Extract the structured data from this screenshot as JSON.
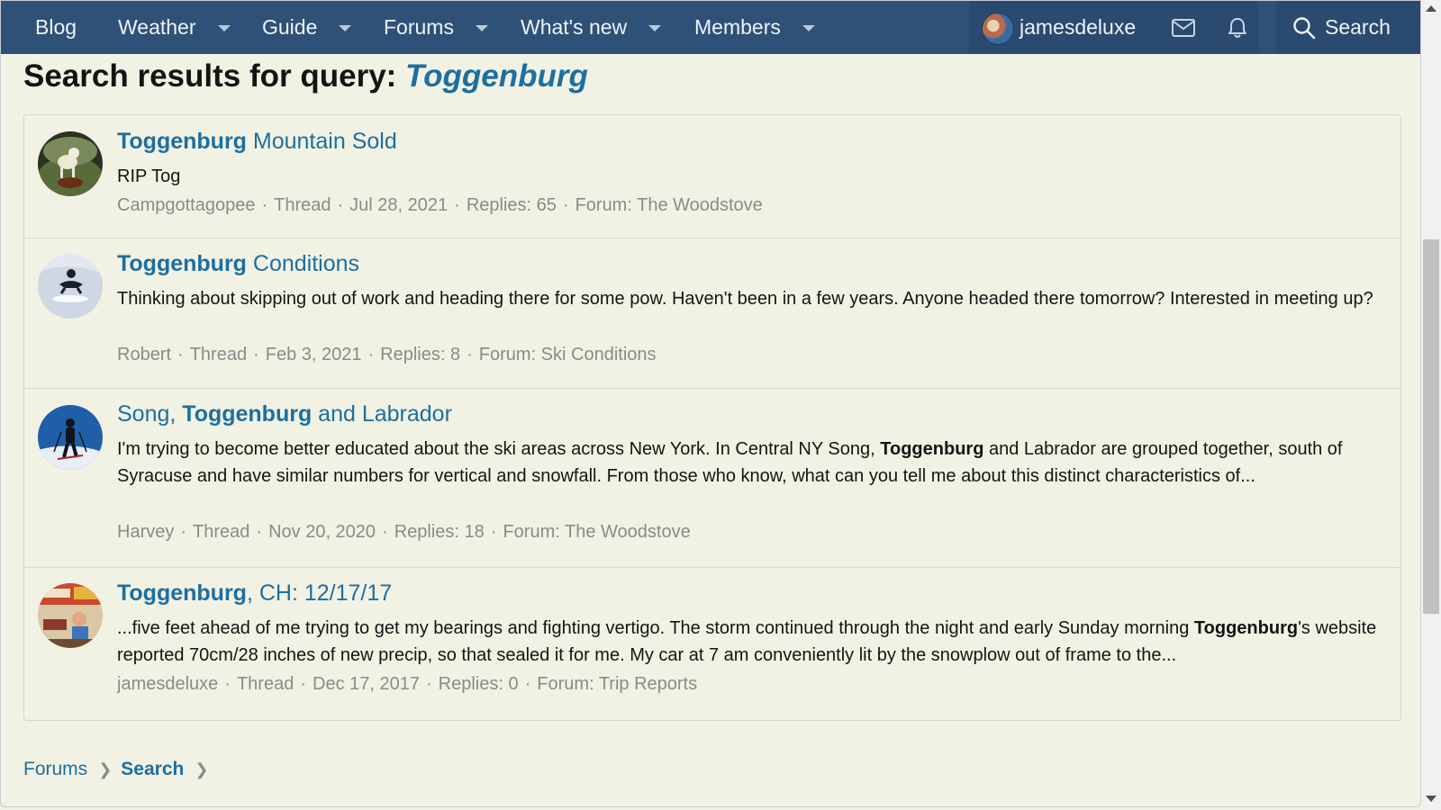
{
  "nav": {
    "items": [
      {
        "label": "Blog",
        "has_menu": false
      },
      {
        "label": "Weather",
        "has_menu": true
      },
      {
        "label": "Guide",
        "has_menu": true
      },
      {
        "label": "Forums",
        "has_menu": true
      },
      {
        "label": "What's new",
        "has_menu": true
      },
      {
        "label": "Members",
        "has_menu": true
      }
    ],
    "username": "jamesdeluxe",
    "search_label": "Search"
  },
  "page": {
    "title_prefix": "Search results for query: ",
    "query": "Toggenburg"
  },
  "results": [
    {
      "title_match": "Toggenburg",
      "title_rest": " Mountain Sold",
      "snippet": "RIP Tog",
      "author": "Campgottagopee",
      "type": "Thread",
      "date": "Jul 28, 2021",
      "replies": "Replies: 65",
      "forum": "Forum: The Woodstove"
    },
    {
      "title_match": "Toggenburg",
      "title_rest": " Conditions",
      "snippet": "Thinking about skipping out of work and heading there for some pow. Haven't been in a few years. Anyone headed there tomorrow? Interested in meeting up?",
      "author": "Robert",
      "type": "Thread",
      "date": "Feb 3, 2021",
      "replies": "Replies: 8",
      "forum": "Forum: Ski Conditions"
    },
    {
      "title_pre": "Song, ",
      "title_match": "Toggenburg",
      "title_rest": " and Labrador",
      "snippet_pre": "I'm trying to become better educated about the ski areas across New York. In Central NY Song, ",
      "snippet_match": "Toggenburg",
      "snippet_post": " and Labrador are grouped together, south of Syracuse and have similar numbers for vertical and snowfall. From those who know, what can you tell me about this distinct characteristics of...",
      "author": "Harvey",
      "type": "Thread",
      "date": "Nov 20, 2020",
      "replies": "Replies: 18",
      "forum": "Forum: The Woodstove"
    },
    {
      "title_match": "Toggenburg",
      "title_rest": ", CH: 12/17/17",
      "snippet_pre": "...five feet ahead of me trying to get my bearings and fighting vertigo. The storm continued through the night and early Sunday morning ",
      "snippet_match": "Toggenburg",
      "snippet_post": "'s website reported 70cm/28 inches of new precip, so that sealed it for me. My car at 7 am conveniently lit by the snowplow out of frame to the...",
      "author": "jamesdeluxe",
      "type": "Thread",
      "date": "Dec 17, 2017",
      "replies": "Replies: 0",
      "forum": "Forum: Trip Reports"
    }
  ],
  "breadcrumb": [
    "Forums",
    "Search"
  ],
  "icons": {
    "mail": "envelope-icon",
    "alerts": "bell-icon",
    "search": "magnifier-icon"
  },
  "colors": {
    "nav_bg": "#2f5178",
    "link": "#1d6fa0",
    "page_bg": "#f2f2e4",
    "meta": "#8a8a8a"
  }
}
